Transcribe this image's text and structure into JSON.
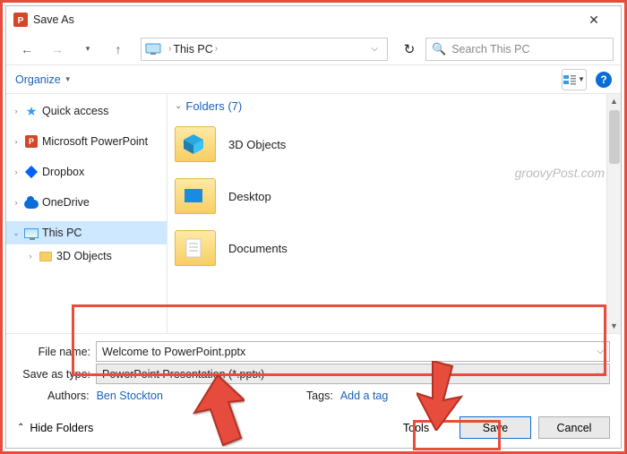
{
  "titlebar": {
    "title": "Save As"
  },
  "nav": {
    "path_label": "This PC",
    "search_placeholder": "Search This PC"
  },
  "toolbar": {
    "organize": "Organize"
  },
  "tree": {
    "items": [
      {
        "label": "Quick access",
        "icon": "star",
        "twisty": ">"
      },
      {
        "label": "Microsoft PowerPoint",
        "icon": "pp",
        "twisty": ">"
      },
      {
        "label": "Dropbox",
        "icon": "dbx",
        "twisty": ">"
      },
      {
        "label": "OneDrive",
        "icon": "cloud",
        "twisty": ">"
      },
      {
        "label": "This PC",
        "icon": "monitor",
        "twisty": "v",
        "selected": true
      },
      {
        "label": "3D Objects",
        "icon": "folder",
        "twisty": ">",
        "indent": true
      }
    ]
  },
  "main_panel": {
    "folders_header": "Folders (7)",
    "folders": [
      {
        "label": "3D Objects"
      },
      {
        "label": "Desktop"
      },
      {
        "label": "Documents"
      }
    ],
    "watermark": "groovyPost.com"
  },
  "fields": {
    "file_name_label": "File name:",
    "file_name_value": "Welcome to PowerPoint.pptx",
    "save_type_label": "Save as type:",
    "save_type_value": "PowerPoint Presentation (*.pptx)",
    "authors_label": "Authors:",
    "authors_value": "Ben Stockton",
    "tags_label": "Tags:",
    "tags_value": "Add a tag"
  },
  "footer": {
    "hide_folders": "Hide Folders",
    "tools": "Tools",
    "save": "Save",
    "cancel": "Cancel"
  }
}
